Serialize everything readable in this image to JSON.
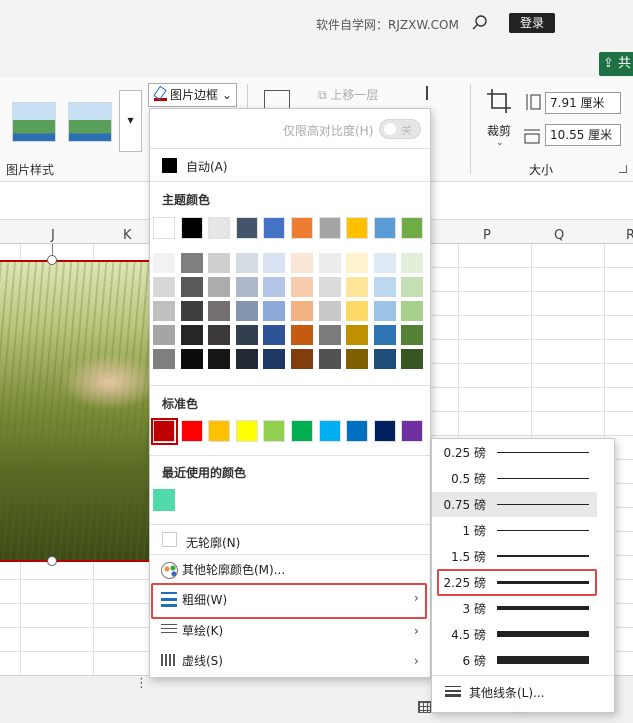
{
  "titlebar": {
    "site": "软件自学网：RJZXW.COM",
    "login": "登录",
    "share": "共"
  },
  "ribbon": {
    "styles_group": "图片样式",
    "styles_more": "▾",
    "border_button": "图片边框",
    "border_caret": "⌄",
    "bring_forward": "上移一层",
    "crop": "裁剪",
    "crop_chevron": "⌄",
    "height": "7.91 厘米",
    "width": "10.55 厘米",
    "size_group": "大小"
  },
  "columns": [
    "J",
    "K",
    "P",
    "Q",
    "R"
  ],
  "border_menu": {
    "contrast_label": "仅限高对比度(H)",
    "contrast_state": "关",
    "auto": "自动(A)",
    "theme_colors_title": "主题颜色",
    "theme_top": [
      "#ffffff",
      "#000000",
      "#e7e6e6",
      "#44546a",
      "#4472c4",
      "#ed7d31",
      "#a5a5a5",
      "#ffc000",
      "#5b9bd5",
      "#70ad47"
    ],
    "theme_tints": [
      [
        "#f2f2f2",
        "#7f7f7f",
        "#d0cece",
        "#d6dce4",
        "#d9e2f3",
        "#fbe5d5",
        "#ededed",
        "#fff2cc",
        "#deebf6",
        "#e2efd9"
      ],
      [
        "#d8d8d8",
        "#595959",
        "#aeabab",
        "#adb9ca",
        "#b4c6e7",
        "#f7cbac",
        "#dbdbdb",
        "#fee599",
        "#bdd7ee",
        "#c5e0b3"
      ],
      [
        "#bfbfbf",
        "#3f3f3f",
        "#757070",
        "#8496b0",
        "#8eaadb",
        "#f4b183",
        "#c9c9c9",
        "#ffd965",
        "#9cc3e5",
        "#a8d08d"
      ],
      [
        "#a5a5a5",
        "#262626",
        "#3a3838",
        "#323f4f",
        "#2f5496",
        "#c55a11",
        "#7b7b7b",
        "#bf9000",
        "#2e75b5",
        "#538135"
      ],
      [
        "#7f7f7f",
        "#0c0c0c",
        "#171616",
        "#222a35",
        "#1f3864",
        "#833c0b",
        "#525252",
        "#7f6000",
        "#1e4e79",
        "#375623"
      ]
    ],
    "standard_title": "标准色",
    "standard_colors": [
      "#c00000",
      "#ff0000",
      "#ffc000",
      "#ffff00",
      "#92d050",
      "#00b050",
      "#00b0f0",
      "#0070c0",
      "#002060",
      "#7030a0"
    ],
    "recent_title": "最近使用的颜色",
    "recent_color": "#50d9a9",
    "no_outline": "无轮廓(N)",
    "more_colors": "其他轮廓颜色(M)...",
    "weight": "粗细(W)",
    "sketch": "草绘(K)",
    "dash": "虚线(S)",
    "submenu_arrow": "›"
  },
  "weight_menu": {
    "items": [
      {
        "label": "0.25 磅",
        "weight": 0.25
      },
      {
        "label": "0.5 磅",
        "weight": 0.5
      },
      {
        "label": "0.75 磅",
        "weight": 0.75
      },
      {
        "label": "1 磅",
        "weight": 1
      },
      {
        "label": "1.5 磅",
        "weight": 1.5
      },
      {
        "label": "2.25 磅",
        "weight": 2.25
      },
      {
        "label": "3 磅",
        "weight": 3
      },
      {
        "label": "4.5 磅",
        "weight": 4.5
      },
      {
        "label": "6 磅",
        "weight": 6
      }
    ],
    "selected": "2.25 磅",
    "hovered": "0.75 磅",
    "more_lines": "其他线条(L)...",
    "grip": "....."
  },
  "status": {
    "sheet_more": "⋮"
  }
}
